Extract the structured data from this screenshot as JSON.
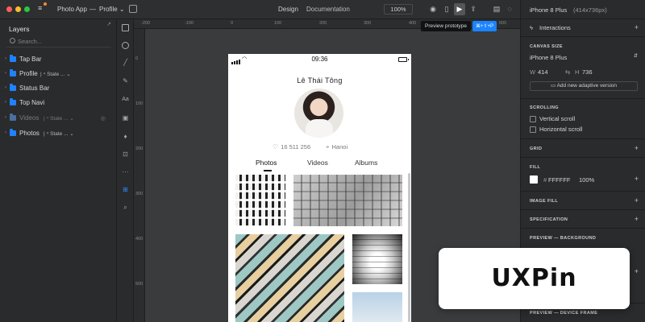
{
  "window": {
    "app_name": "Photo App",
    "separator": "—",
    "page_name": "Profile ⌄",
    "toolbar": {
      "mode_design": "Design",
      "mode_documentation": "Documentation",
      "zoom": "100%",
      "tooltip": "Preview prototype",
      "shortcut": "⌘+⇧+P"
    }
  },
  "layers": {
    "title": "Layers",
    "search_placeholder": "Search...",
    "items": [
      {
        "label": "Tap Bar",
        "state": ""
      },
      {
        "label": "Profile",
        "state": "| ⁴ State ... ⌄"
      },
      {
        "label": "Status Bar",
        "state": ""
      },
      {
        "label": "Top Navi",
        "state": ""
      },
      {
        "label": "Videos",
        "state": "| ⁴ State ... ⌄"
      },
      {
        "label": "Photos",
        "state": "| ⁴ State ... ⌄"
      }
    ]
  },
  "rulers": {
    "top": [
      "-200",
      "-100",
      "0",
      "100",
      "200",
      "300",
      "400",
      "500",
      "600"
    ],
    "left": [
      "0",
      "100",
      "200",
      "300",
      "400",
      "500"
    ]
  },
  "phone": {
    "time": "09:36",
    "profile_name": "Lê Thái Tông",
    "likes": "16 511 256",
    "location": "Hanoi",
    "tabs": [
      "Photos",
      "Videos",
      "Albums"
    ]
  },
  "properties": {
    "device": "iPhone 8 Plus",
    "device_size": "(414x736px)",
    "interactions": "Interactions",
    "canvas_size_label": "CANVAS SIZE",
    "canvas_device": "iPhone 8 Plus",
    "width_label": "W",
    "width": "414",
    "height_label": "H",
    "height": "736",
    "adaptive_button": "Add new adaptive version",
    "scrolling_label": "SCROLLING",
    "vertical_scroll": "Vertical scroll",
    "horizontal_scroll": "Horizontal scroll",
    "grid_label": "GRID",
    "fill_label": "FILL",
    "fill_color": "#FFFFFF",
    "fill_hex": "FFFFFF",
    "fill_opacity": "100%",
    "image_fill_label": "IMAGE FILL",
    "specification_label": "SPECIFICATION",
    "preview_background_label": "PREVIEW — BACKGROUND",
    "preview_device_frame_label": "PREVIEW — DEVICE FRAME"
  },
  "watermark": {
    "brand": "UXPin"
  }
}
